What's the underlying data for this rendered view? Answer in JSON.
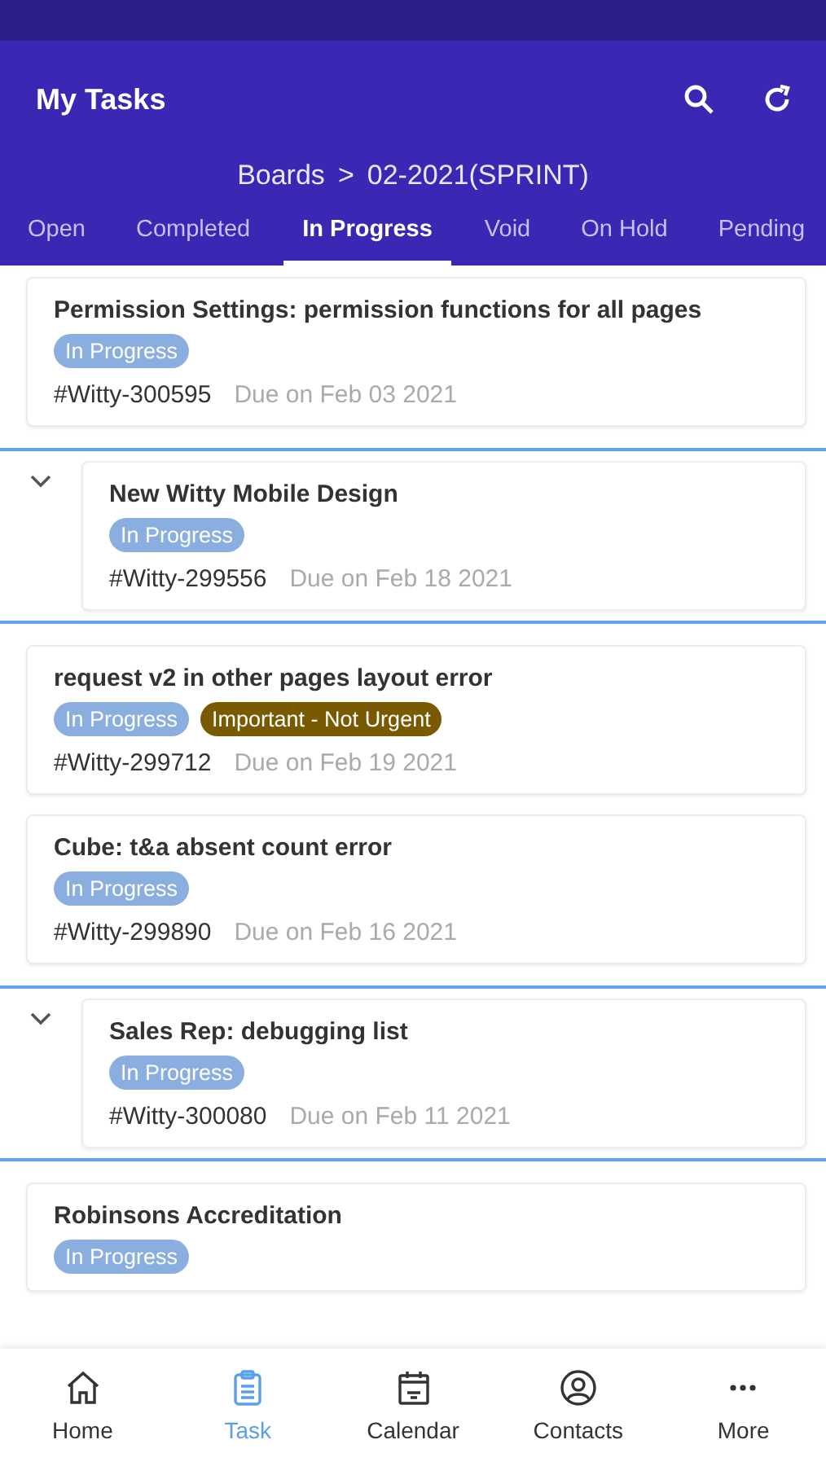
{
  "header": {
    "title": "My Tasks"
  },
  "breadcrumb": {
    "root": "Boards",
    "separator": ">",
    "current": "02-2021(SPRINT)"
  },
  "tabs": [
    {
      "label": "Open",
      "selected": false
    },
    {
      "label": "Completed",
      "selected": false
    },
    {
      "label": "In Progress",
      "selected": true
    },
    {
      "label": "Void",
      "selected": false
    },
    {
      "label": "On Hold",
      "selected": false
    },
    {
      "label": "Pending",
      "selected": false
    }
  ],
  "tasks": [
    {
      "kind": "plain",
      "title": "Permission Settings: permission functions for all pages",
      "tags": [
        {
          "label": "In Progress",
          "color": "#8aaee0"
        }
      ],
      "id": "#Witty-300595",
      "due": "Due on Feb 03 2021"
    },
    {
      "kind": "grouped",
      "expanded": true,
      "title": "New Witty Mobile Design",
      "tags": [
        {
          "label": "In Progress",
          "color": "#8aaee0"
        }
      ],
      "id": "#Witty-299556",
      "due": "Due on Feb 18 2021"
    },
    {
      "kind": "plain",
      "title": "request v2 in other pages layout error",
      "tags": [
        {
          "label": "In Progress",
          "color": "#8aaee0"
        },
        {
          "label": "Important - Not Urgent",
          "color": "#7a5a00"
        }
      ],
      "id": "#Witty-299712",
      "due": "Due on Feb 19 2021"
    },
    {
      "kind": "plain",
      "title": "Cube: t&a absent count error",
      "tags": [
        {
          "label": "In Progress",
          "color": "#8aaee0"
        }
      ],
      "id": "#Witty-299890",
      "due": "Due on Feb 16 2021"
    },
    {
      "kind": "grouped",
      "expanded": true,
      "title": "Sales Rep: debugging list",
      "tags": [
        {
          "label": "In Progress",
          "color": "#8aaee0"
        }
      ],
      "id": "#Witty-300080",
      "due": "Due on Feb 11 2021"
    },
    {
      "kind": "plain",
      "title": "Robinsons Accreditation",
      "tags": [
        {
          "label": "In Progress",
          "color": "#8aaee0"
        }
      ]
    }
  ],
  "nav": [
    {
      "kind": "home",
      "label": "Home",
      "selected": false
    },
    {
      "kind": "task",
      "label": "Task",
      "selected": true
    },
    {
      "kind": "calendar",
      "label": "Calendar",
      "selected": false
    },
    {
      "kind": "contacts",
      "label": "Contacts",
      "selected": false
    },
    {
      "kind": "more",
      "label": "More",
      "selected": false
    }
  ]
}
